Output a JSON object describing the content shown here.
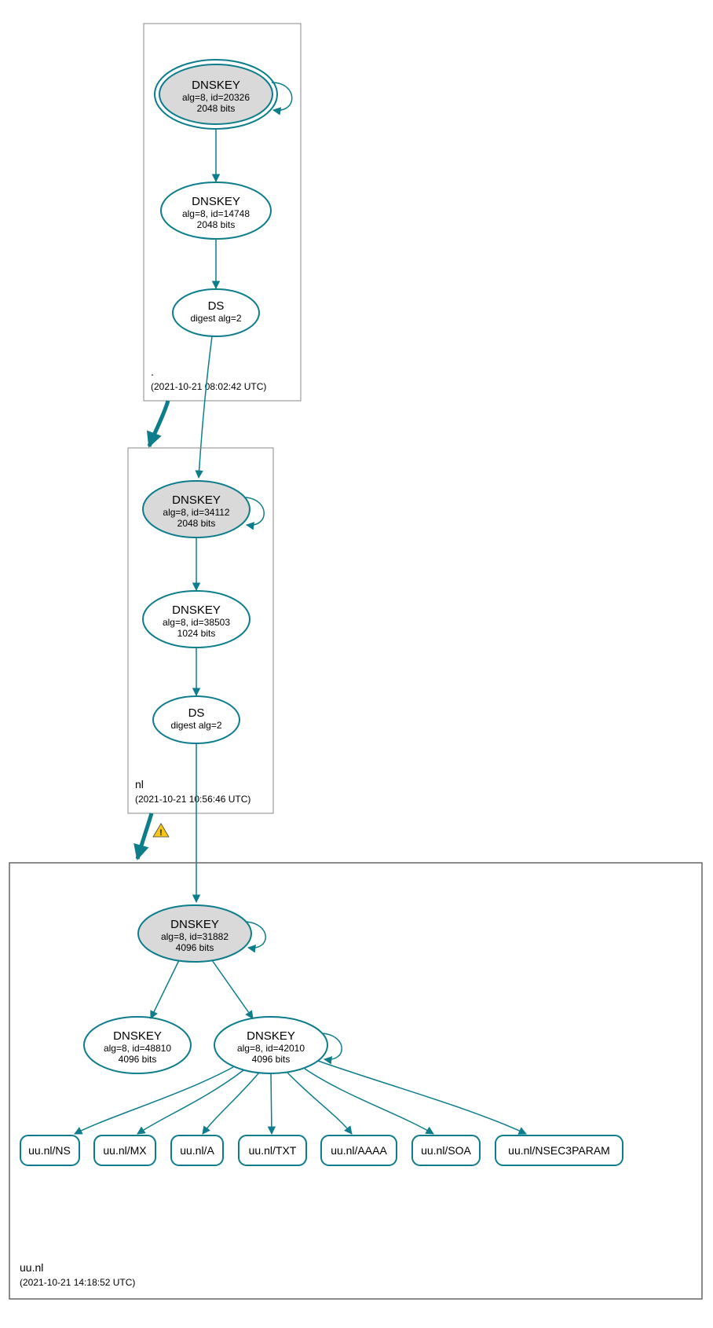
{
  "zones": {
    "root": {
      "name": ".",
      "timestamp": "(2021-10-21 08:02:42 UTC)",
      "dnskey_ksk": {
        "title": "DNSKEY",
        "sub1": "alg=8, id=20326",
        "sub2": "2048 bits"
      },
      "dnskey_zsk": {
        "title": "DNSKEY",
        "sub1": "alg=8, id=14748",
        "sub2": "2048 bits"
      },
      "ds": {
        "title": "DS",
        "sub1": "digest alg=2"
      }
    },
    "nl": {
      "name": "nl",
      "timestamp": "(2021-10-21 10:56:46 UTC)",
      "dnskey_ksk": {
        "title": "DNSKEY",
        "sub1": "alg=8, id=34112",
        "sub2": "2048 bits"
      },
      "dnskey_zsk": {
        "title": "DNSKEY",
        "sub1": "alg=8, id=38503",
        "sub2": "1024 bits"
      },
      "ds": {
        "title": "DS",
        "sub1": "digest alg=2"
      }
    },
    "uu": {
      "name": "uu.nl",
      "timestamp": "(2021-10-21 14:18:52 UTC)",
      "dnskey_ksk": {
        "title": "DNSKEY",
        "sub1": "alg=8, id=31882",
        "sub2": "4096 bits"
      },
      "dnskey_zsk1": {
        "title": "DNSKEY",
        "sub1": "alg=8, id=48810",
        "sub2": "4096 bits"
      },
      "dnskey_zsk2": {
        "title": "DNSKEY",
        "sub1": "alg=8, id=42010",
        "sub2": "4096 bits"
      },
      "rrsets": {
        "ns": "uu.nl/NS",
        "mx": "uu.nl/MX",
        "a": "uu.nl/A",
        "txt": "uu.nl/TXT",
        "aaaa": "uu.nl/AAAA",
        "soa": "uu.nl/SOA",
        "nsec3": "uu.nl/NSEC3PARAM"
      }
    }
  },
  "warning_label": "!"
}
